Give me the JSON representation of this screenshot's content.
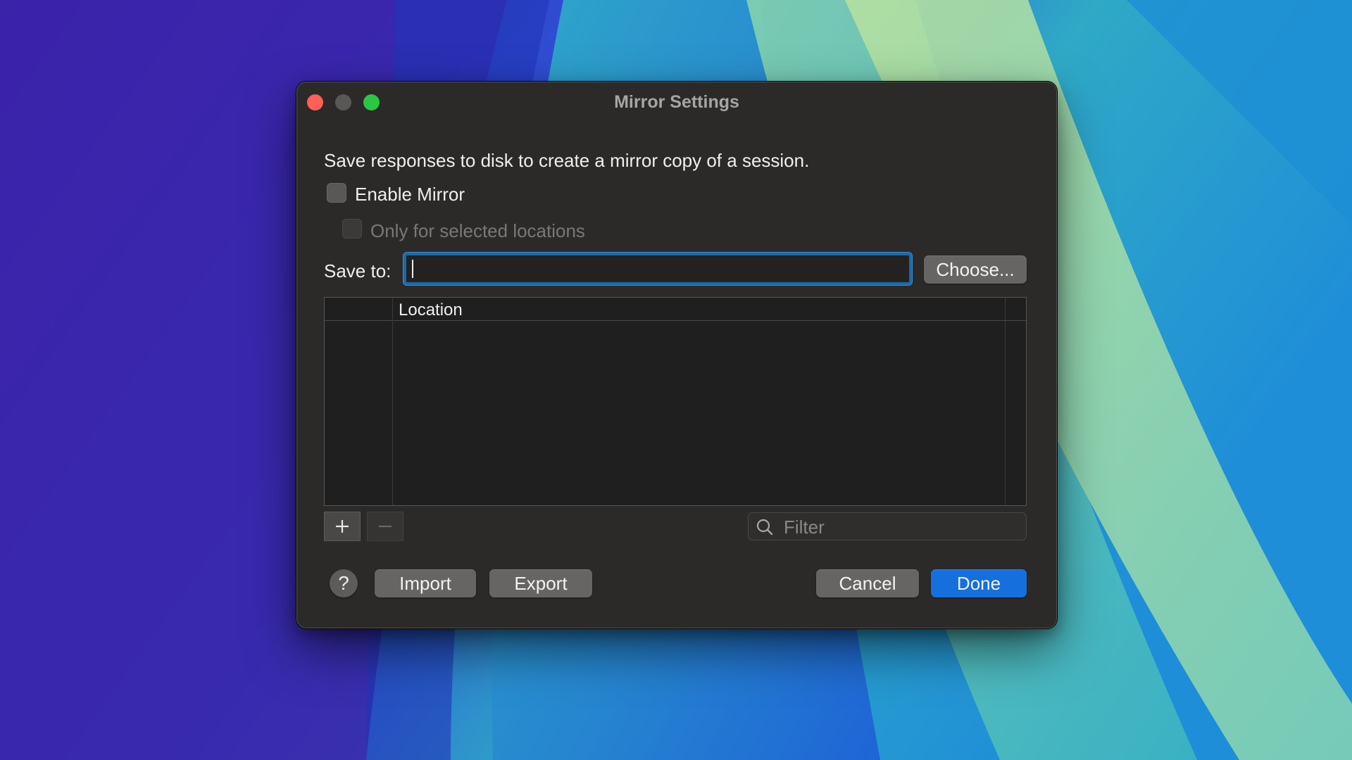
{
  "window": {
    "title": "Mirror Settings"
  },
  "dialog": {
    "description": "Save responses to disk to create a mirror copy of a session.",
    "enable_mirror_label": "Enable Mirror",
    "enable_mirror_checked": false,
    "only_selected_label": "Only for selected locations",
    "only_selected_checked": false,
    "only_selected_enabled": false,
    "save_to_label": "Save to:",
    "save_to_value": "",
    "choose_label": "Choose...",
    "table": {
      "columns": [
        "",
        "Location"
      ],
      "rows": []
    },
    "filter_placeholder": "Filter",
    "help_label": "?",
    "import_label": "Import",
    "export_label": "Export",
    "cancel_label": "Cancel",
    "done_label": "Done"
  },
  "colors": {
    "accent": "#1570de",
    "focus_ring": "#1a6aa6"
  },
  "icons": {
    "add": "plus-icon",
    "remove": "minus-icon",
    "search": "magnifier-icon"
  }
}
